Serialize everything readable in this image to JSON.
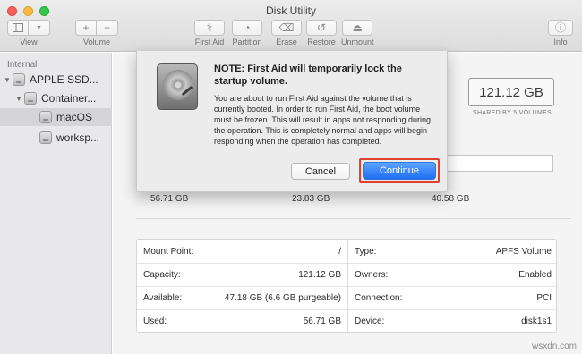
{
  "window": {
    "title": "Disk Utility"
  },
  "toolbar": {
    "view": {
      "label": "View",
      "icon": "sidebar-icon"
    },
    "volume": {
      "label": "Volume",
      "add_icon": "plus-icon",
      "remove_icon": "minus-icon"
    },
    "first_aid": {
      "label": "First Aid",
      "icon": "stethoscope-icon"
    },
    "partition": {
      "label": "Partition",
      "icon": "pie-icon"
    },
    "erase": {
      "label": "Erase",
      "icon": "erase-icon"
    },
    "restore": {
      "label": "Restore",
      "icon": "restore-icon"
    },
    "unmount": {
      "label": "Unmount",
      "icon": "eject-icon"
    },
    "info": {
      "label": "Info",
      "icon": "info-icon"
    }
  },
  "sidebar": {
    "header": "Internal",
    "items": [
      {
        "label": "APPLE SSD..."
      },
      {
        "label": "Container..."
      },
      {
        "label": "macOS"
      },
      {
        "label": "worksp..."
      }
    ]
  },
  "main": {
    "capacity": "121.12 GB",
    "shared_label": "SHARED BY 5 VOLUMES",
    "usage": [
      "56.71 GB",
      "23.83 GB",
      "40.58 GB"
    ],
    "info_left": [
      {
        "key": "Mount Point:",
        "value": "/"
      },
      {
        "key": "Capacity:",
        "value": "121.12 GB"
      },
      {
        "key": "Available:",
        "value": "47.18 GB (6.6 GB purgeable)"
      },
      {
        "key": "Used:",
        "value": "56.71 GB"
      }
    ],
    "info_right": [
      {
        "key": "Type:",
        "value": "APFS Volume"
      },
      {
        "key": "Owners:",
        "value": "Enabled"
      },
      {
        "key": "Connection:",
        "value": "PCI"
      },
      {
        "key": "Device:",
        "value": "disk1s1"
      }
    ]
  },
  "dialog": {
    "title": "NOTE: First Aid will temporarily lock the startup volume.",
    "body": "You are about to run First Aid against the volume that is currently booted. In order to run First Aid, the boot volume must be frozen. This will result in apps not responding during the operation. This is completely normal and apps will begin responding when the operation has completed.",
    "cancel_label": "Cancel",
    "continue_label": "Continue",
    "icon": "hard-drive-icon"
  },
  "watermark": "wsxdn.com",
  "colors": {
    "accent": "#1f6ff2",
    "highlight_outline": "#e0412e"
  }
}
